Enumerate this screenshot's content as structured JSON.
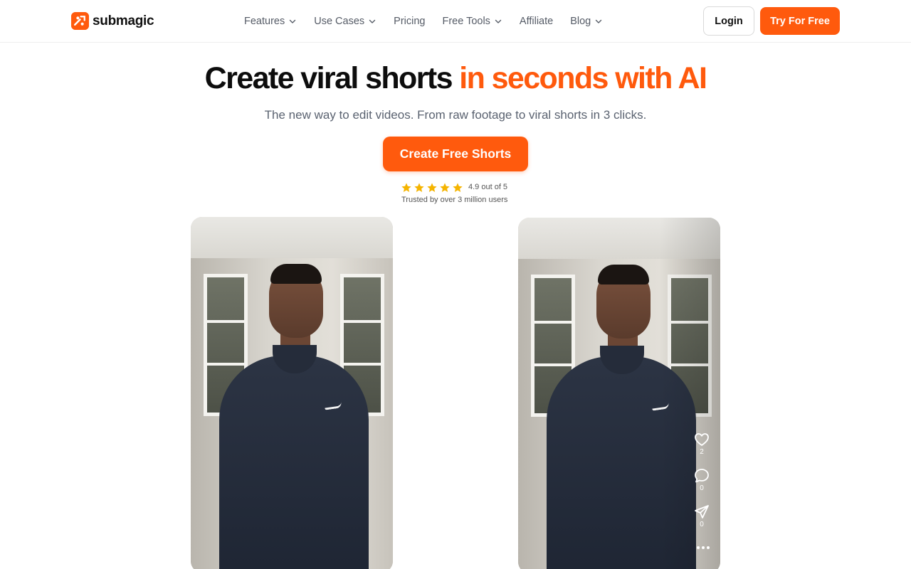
{
  "brand": {
    "name": "submagic",
    "accent": "#ff5a0d",
    "logo_icon": "submagic-logo-icon"
  },
  "nav": {
    "items": [
      {
        "label": "Features",
        "has_dropdown": true
      },
      {
        "label": "Use Cases",
        "has_dropdown": true
      },
      {
        "label": "Pricing",
        "has_dropdown": false
      },
      {
        "label": "Free Tools",
        "has_dropdown": true
      },
      {
        "label": "Affiliate",
        "has_dropdown": false
      },
      {
        "label": "Blog",
        "has_dropdown": true
      }
    ],
    "login_label": "Login",
    "try_label": "Try For Free"
  },
  "hero": {
    "title_part1": "Create viral shorts ",
    "title_part2": "in seconds with AI",
    "subtitle": "The new way to edit videos. From raw footage to viral shorts in 3 clicks.",
    "cta_label": "Create Free Shorts",
    "rating_text": "4.9 out of 5",
    "rating_stars": 5,
    "rating_value": 4.9,
    "star_color": "#f5b400",
    "trust_text": "Trusted by over 3 million users"
  },
  "preview": {
    "before_video": "raw-footage-video",
    "after_video": "edited-short-video",
    "actions": [
      {
        "icon": "heart-icon",
        "count": "2"
      },
      {
        "icon": "comment-icon",
        "count": "0"
      },
      {
        "icon": "share-icon",
        "count": "0"
      }
    ],
    "more_icon": "more-dots-icon"
  }
}
